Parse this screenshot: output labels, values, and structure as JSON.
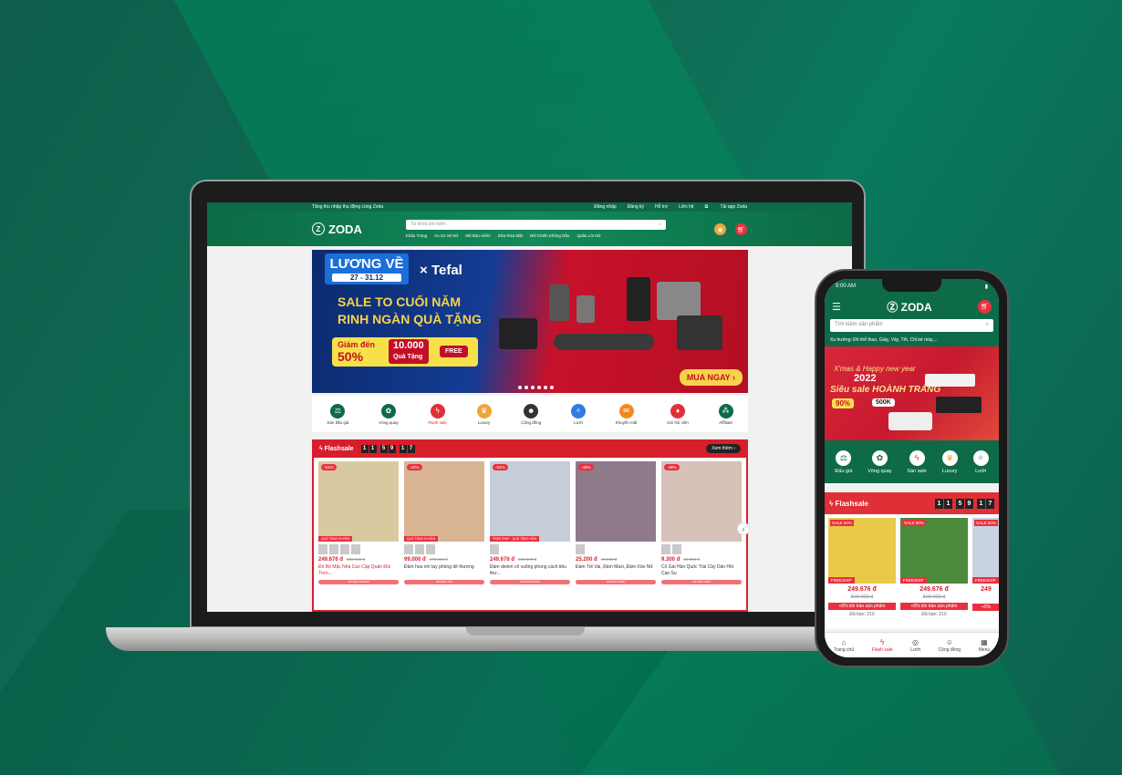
{
  "desktop": {
    "topbar": {
      "promo": "Tăng thu nhập thụ động cùng Zoda",
      "links": [
        "Đăng nhập",
        "Đăng ký",
        "Hỗ trợ",
        "Liên hệ",
        "Tải app Zoda"
      ]
    },
    "header": {
      "logo": "ZODA",
      "search_placeholder": "Từ khóa tìm kiếm",
      "tags": [
        "Khẩu Trang",
        "Áo Sơ Mi Nữ",
        "Mũ Bảo Hiểm",
        "Sữa Rửa Mặt",
        "Nồi Chiên Không Dầu",
        "Quần Lót Nữ"
      ]
    },
    "banner": {
      "title": "LƯƠNG VỀ",
      "dates": "27 - 31.12",
      "brand": "Tefal",
      "headline_1": "SALE TO CUỐI NĂM",
      "headline_2": "RINH NGÀN QUÀ TẶNG",
      "discount_label": "Giảm đến",
      "discount_value": "50%",
      "gift_value": "10.000",
      "gift_label": "Quà Tặng",
      "free_label": "FREE",
      "cta": "MUA NGAY"
    },
    "categories": [
      {
        "label": "Sàn đấu giá",
        "color": "#0e6b48"
      },
      {
        "label": "Vòng quay",
        "color": "#0e6b48"
      },
      {
        "label": "Flash sale",
        "color": "#e03037"
      },
      {
        "label": "Luxury",
        "color": "#f0a53a"
      },
      {
        "label": "Cộng đồng",
        "color": "#333333"
      },
      {
        "label": "Lướt",
        "color": "#2d7de0"
      },
      {
        "label": "Khuyến mãi",
        "color": "#f08a1e"
      },
      {
        "label": "Gói hội viên",
        "color": "#e03037"
      },
      {
        "label": "Affiliate",
        "color": "#0e6b48"
      }
    ],
    "flashsale": {
      "title": "Flashsale",
      "timer": [
        "1",
        "1",
        "5",
        "9",
        "1",
        "7"
      ],
      "more": "Xem thêm",
      "products": [
        {
          "discount": "-51%",
          "tag": "QUÀ TẶNG ĐI KÈM",
          "price": "249.676 đ",
          "old": "509.000 đ",
          "name": "Đồ Bộ Mặc Nhà Cao Cấp Quần Đùi Trơn...",
          "sold": "ĐÃ BÁN 100/300",
          "color": "#d9c9a0"
        },
        {
          "discount": "-42%",
          "tag": "QUÀ TẶNG ĐI KÈM",
          "price": "99.000 đ",
          "old": "170.000 đ",
          "name": "Đầm hoa nhí tay phồng dễ thương",
          "sold": "ĐÃ BÁN 4/20",
          "color": "#d9b493"
        },
        {
          "discount": "-51%",
          "tag": "FREE SHIP · QUÀ TẶNG KÈM",
          "price": "249.676 đ",
          "old": "509.000 đ",
          "name": "Đầm denim cổ vuông phong cách tiểu thư...",
          "sold": "ĐÃ BÁN 95/100",
          "color": "#c4cdd8"
        },
        {
          "discount": "-48%",
          "tag": "",
          "price": "25.200 đ",
          "old": "49.000 đ",
          "name": "Đầm Trễ Vai, Đầm Maxi, Đầm Xòe Nữ",
          "sold": "ĐÃ BÁN 20/35",
          "color": "#8f7a8a"
        },
        {
          "discount": "-48%",
          "tag": "",
          "price": "9.300 đ",
          "old": "19.000 đ",
          "name": "Cô Gái Hàn Quốc Trái Cây Dán Hồi Cao Su",
          "sold": "ĐÃ BÁN 15/50",
          "color": "#d6c2b8"
        }
      ]
    }
  },
  "mobile": {
    "status_time": "9:00 AM",
    "logo": "ZODA",
    "search_placeholder": "Tìm kiếm sản phẩm",
    "trending": "Xu hướng: Đồ thể thao, Giày, Váy, Tết, Chỉ kẻ mày,...",
    "banner": {
      "greeting": "X'mas & Happy new year",
      "year": "2022",
      "headline": "Siêu sale HOÀNH TRÁNG",
      "percent": "90%",
      "voucher": "500K"
    },
    "categories": [
      "Đấu giá",
      "Vòng quay",
      "Sàn sale",
      "Luxury",
      "Lướt"
    ],
    "flashsale": {
      "title": "Flashsale",
      "timer": [
        "1",
        "1",
        "5",
        "9",
        "1",
        "7"
      ],
      "products": [
        {
          "sale": "SALE 50%",
          "tag": "FREESHIP",
          "price": "249.676 đ",
          "old": "509.000 đ",
          "bonus": "+5% khi bán sản phẩm",
          "sold": "Đã bán: 210",
          "color": "#e8c94a"
        },
        {
          "sale": "SALE 50%",
          "tag": "FREESHIP",
          "price": "249.676 đ",
          "old": "509.000 đ",
          "bonus": "+5% khi bán sản phẩm",
          "sold": "Đã bán: 210",
          "color": "#4c8a3c"
        },
        {
          "sale": "SALE 50%",
          "tag": "FREESHIP",
          "price": "249",
          "old": "",
          "bonus": "+5%",
          "sold": "",
          "color": "#c9d3e0"
        }
      ]
    },
    "nav": [
      "Trang chủ",
      "Flash sale",
      "Lướt",
      "Cộng đồng",
      "Menu"
    ]
  }
}
